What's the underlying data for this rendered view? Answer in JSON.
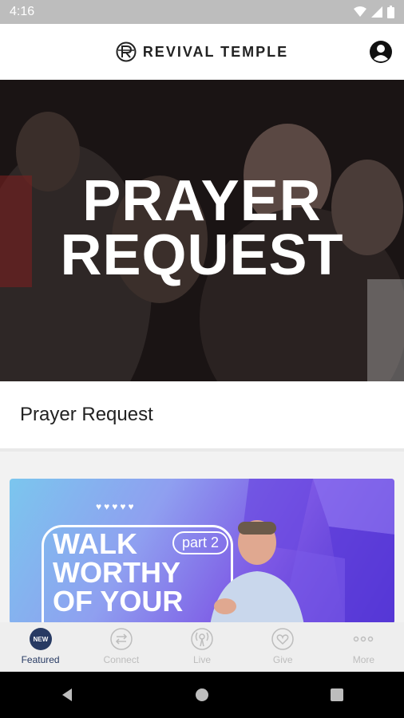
{
  "status_bar": {
    "time": "4:16"
  },
  "header": {
    "brand": "REVIVAL TEMPLE"
  },
  "hero": {
    "title_line1": "PRAYER",
    "title_line2": "REQUEST"
  },
  "card": {
    "label": "Prayer Request"
  },
  "promo": {
    "title_line1": "WALK",
    "title_line2": "WORTHY",
    "title_line3": "OF YOUR",
    "badge": "part 2",
    "hearts": "♥♥♥♥♥"
  },
  "tabs": [
    {
      "label": "Featured",
      "icon": "new-badge-icon",
      "active": true,
      "badge": "NEW"
    },
    {
      "label": "Connect",
      "icon": "arrows-swap-icon",
      "active": false
    },
    {
      "label": "Live",
      "icon": "broadcast-icon",
      "active": false
    },
    {
      "label": "Give",
      "icon": "heart-icon",
      "active": false
    },
    {
      "label": "More",
      "icon": "ellipsis-icon",
      "active": false
    }
  ],
  "colors": {
    "accent": "#273a63",
    "tab_inactive": "#bdbdbd",
    "status_bar": "#bdbdbd"
  }
}
